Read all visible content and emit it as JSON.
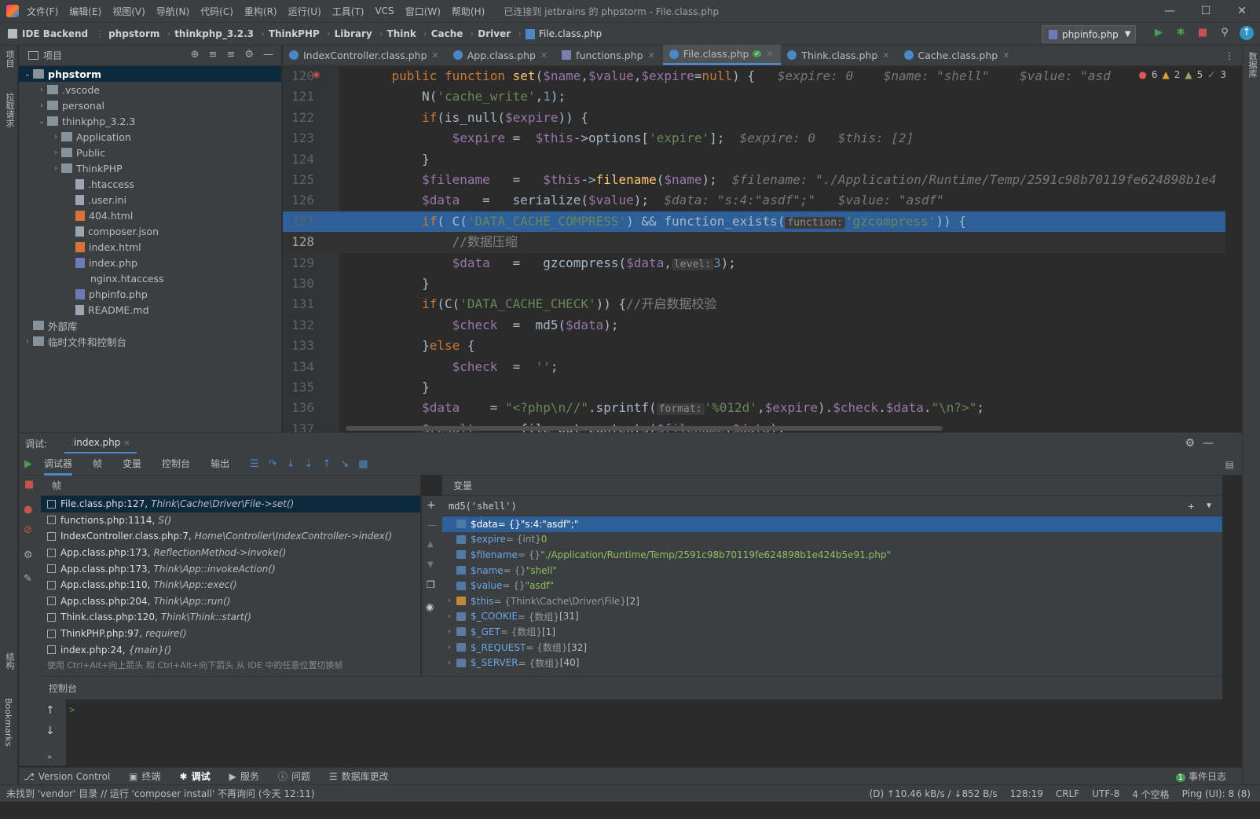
{
  "title": {
    "menu": [
      "文件(F)",
      "编辑(E)",
      "视图(V)",
      "导航(N)",
      "代码(C)",
      "重构(R)",
      "运行(U)",
      "工具(T)",
      "VCS",
      "窗口(W)",
      "帮助(H)"
    ],
    "window_title": "已连接到 jetbrains 的 phpstorm - File.class.php",
    "controls": [
      "—",
      "☐",
      "✕"
    ]
  },
  "nav": {
    "project_label": "IDE Backend",
    "breadcrumbs": [
      "phpstorm",
      "thinkphp_3.2.3",
      "ThinkPHP",
      "Library",
      "Think",
      "Cache",
      "Driver"
    ],
    "current_file": "File.class.php",
    "run_config": "phpinfo.php"
  },
  "left_strip": {
    "project": "项目",
    "pull": "拉取请求",
    "structure": "结构",
    "bookmarks": "Bookmarks"
  },
  "right_strip": {
    "db": "数据库"
  },
  "project": {
    "header": "项目",
    "items": [
      {
        "label": "phpstorm",
        "depth": 0,
        "arrow": "⌄",
        "type": "folder",
        "sel": true
      },
      {
        "label": ".vscode",
        "depth": 1,
        "arrow": "›",
        "type": "folder"
      },
      {
        "label": "personal",
        "depth": 1,
        "arrow": "›",
        "type": "folder"
      },
      {
        "label": "thinkphp_3.2.3",
        "depth": 1,
        "arrow": "⌄",
        "type": "folder"
      },
      {
        "label": "Application",
        "depth": 2,
        "arrow": "›",
        "type": "folder"
      },
      {
        "label": "Public",
        "depth": 2,
        "arrow": "›",
        "type": "folder"
      },
      {
        "label": "ThinkPHP",
        "depth": 2,
        "arrow": "›",
        "type": "folder"
      },
      {
        "label": ".htaccess",
        "depth": 3,
        "arrow": "",
        "type": "file"
      },
      {
        "label": ".user.ini",
        "depth": 3,
        "arrow": "",
        "type": "file"
      },
      {
        "label": "404.html",
        "depth": 3,
        "arrow": "",
        "type": "html"
      },
      {
        "label": "composer.json",
        "depth": 3,
        "arrow": "",
        "type": "file"
      },
      {
        "label": "index.html",
        "depth": 3,
        "arrow": "",
        "type": "html"
      },
      {
        "label": "index.php",
        "depth": 3,
        "arrow": "",
        "type": "php"
      },
      {
        "label": "nginx.htaccess",
        "depth": 3,
        "arrow": "",
        "type": "none"
      },
      {
        "label": "phpinfo.php",
        "depth": 3,
        "arrow": "",
        "type": "php"
      },
      {
        "label": "README.md",
        "depth": 3,
        "arrow": "",
        "type": "file"
      },
      {
        "label": "外部库",
        "depth": 0,
        "arrow": "",
        "type": "lib"
      },
      {
        "label": "临时文件和控制台",
        "depth": 0,
        "arrow": "›",
        "type": "lib"
      }
    ]
  },
  "tabs": [
    {
      "label": "IndexController.class.php",
      "active": false
    },
    {
      "label": "App.class.php",
      "active": false
    },
    {
      "label": "functions.php",
      "active": false
    },
    {
      "label": "File.class.php",
      "active": true
    },
    {
      "label": "Think.class.php",
      "active": false
    },
    {
      "label": "Cache.class.php",
      "active": false
    }
  ],
  "editor": {
    "errors": {
      "errors": "6",
      "warnings": "2",
      "weak": "5",
      "ok": "3"
    },
    "lines": [
      {
        "n": "120",
        "html": "    <span class='kw'>public function </span><span class='fn'>set</span>(<span class='var'>$name</span>,<span class='var'>$value</span>,<span class='var'>$expire</span>=<span class='kw'>null</span>) {   <span class='inl'>$expire: 0    $name: \"shell\"    $value: \"asd</span>"
      },
      {
        "n": "121",
        "html": "        N(<span class='str'>'cache_write'</span>,<span class='num'>1</span>);"
      },
      {
        "n": "122",
        "html": "        <span class='kw'>if</span>(is_null(<span class='var'>$expire</span>)) {"
      },
      {
        "n": "123",
        "html": "            <span class='var'>$expire</span> =  <span class='var'>$this</span>->options[<span class='str'>'expire'</span>];  <span class='inl'>$expire: 0   $this: [2]</span>"
      },
      {
        "n": "124",
        "html": "        }"
      },
      {
        "n": "125",
        "html": "        <span class='var'>$filename</span>   =   <span class='var'>$this</span>-><span class='fn'>filename</span>(<span class='var'>$name</span>);  <span class='inl'>$filename: \"./Application/Runtime/Temp/2591c98b70119fe624898b1e4</span>"
      },
      {
        "n": "126",
        "html": "        <span class='var'>$data</span>   =   serialize(<span class='var'>$value</span>);  <span class='inl'>$data: \"s:4:\"asdf\";\"   $value: \"asdf\"</span>"
      },
      {
        "n": "127",
        "html": "        <span class='kw'>if</span>( C(<span class='str'>'DATA_CACHE_COMPRESS'</span>) && function_exists(<span class='hint'>function:</span><span class='str'>'gzcompress'</span>)) {",
        "hl": true
      },
      {
        "n": "128",
        "html": "            <span class='cm'>//数据压缩</span>",
        "cur": true
      },
      {
        "n": "129",
        "html": "            <span class='var'>$data</span>   =   gzcompress(<span class='var'>$data</span>,<span class='hint'>level:</span><span class='num'>3</span>);"
      },
      {
        "n": "130",
        "html": "        }"
      },
      {
        "n": "131",
        "html": "        <span class='kw'>if</span>(C(<span class='str'>'DATA_CACHE_CHECK'</span>)) {<span class='cm'>//开启数据校验</span>"
      },
      {
        "n": "132",
        "html": "            <span class='var'>$check</span>  =  md5(<span class='var'>$data</span>);"
      },
      {
        "n": "133",
        "html": "        }<span class='kw'>else</span> {"
      },
      {
        "n": "134",
        "html": "            <span class='var'>$check</span>  =  <span class='str'>''</span>;"
      },
      {
        "n": "135",
        "html": "        }"
      },
      {
        "n": "136",
        "html": "        <span class='var'>$data</span>    = <span class='str'>\"&lt;?php\\n//\"</span>.sprintf(<span class='hint'>format:</span><span class='str'>'%012d'</span>,<span class='var'>$expire</span>).<span class='var'>$check</span>.<span class='var'>$data</span>.<span class='str'>\"\\n?&gt;\"</span>;"
      },
      {
        "n": "137",
        "html": "        <span class='var'>$result</span>  =   file_put_contents(<span class='var'>$filename</span>,<span class='var'>$data</span>);"
      }
    ]
  },
  "debug": {
    "label": "调试:",
    "session_tab": "index.php",
    "tabs": [
      "调试器",
      "帧",
      "变量",
      "控制台",
      "输出"
    ],
    "frames_header": "帧",
    "vars_header": "变量",
    "frames": [
      {
        "loc": "File.class.php:127,",
        "ctx": "Think\\Cache\\Driver\\File->set()",
        "sel": true
      },
      {
        "loc": "functions.php:1114,",
        "ctx": "S()"
      },
      {
        "loc": "IndexController.class.php:7,",
        "ctx": "Home\\Controller\\IndexController->index()"
      },
      {
        "loc": "App.class.php:173,",
        "ctx": "ReflectionMethod->invoke()"
      },
      {
        "loc": "App.class.php:173,",
        "ctx": "Think\\App::invokeAction()"
      },
      {
        "loc": "App.class.php:110,",
        "ctx": "Think\\App::exec()"
      },
      {
        "loc": "App.class.php:204,",
        "ctx": "Think\\App::run()"
      },
      {
        "loc": "Think.class.php:120,",
        "ctx": "Think\\Think::start()"
      },
      {
        "loc": "ThinkPHP.php:97,",
        "ctx": "require()"
      },
      {
        "loc": "index.php:24,",
        "ctx": "{main}()"
      }
    ],
    "frames_hint": "使用 Ctrl+Alt+向上箭头 和 Ctrl+Alt+向下箭头 从 IDE 中的任意位置切换帧",
    "watch": "md5('shell')",
    "vars": [
      {
        "arrow": "",
        "name": "$data",
        "type": " = {} ",
        "val": "\"s:4:\"asdf\";\"",
        "sel": true
      },
      {
        "arrow": "",
        "name": "$expire",
        "type": " = {int} ",
        "val": "0"
      },
      {
        "arrow": "",
        "name": "$filename",
        "type": " = {} ",
        "val": "\"./Application/Runtime/Temp/2591c98b70119fe624898b1e424b5e91.php\""
      },
      {
        "arrow": "",
        "name": "$name",
        "type": " = {} ",
        "val": "\"shell\""
      },
      {
        "arrow": "",
        "name": "$value",
        "type": " = {} ",
        "val": "\"asdf\""
      },
      {
        "arrow": "›",
        "name": "$this",
        "type": " = {Think\\Cache\\Driver\\File} ",
        "val": "[2]"
      },
      {
        "arrow": "›",
        "name": "$_COOKIE",
        "type": " = {数组} ",
        "val": "[31]"
      },
      {
        "arrow": "›",
        "name": "$_GET",
        "type": " = {数组} ",
        "val": "[1]"
      },
      {
        "arrow": "›",
        "name": "$_REQUEST",
        "type": " = {数组} ",
        "val": "[32]"
      },
      {
        "arrow": "›",
        "name": "$_SERVER",
        "type": " = {数组} ",
        "val": "[40]"
      }
    ],
    "console_label": "控制台",
    "console_prompt": ">"
  },
  "toolwindows": [
    "Version Control",
    "终端",
    "调试",
    "服务",
    "问题",
    "数据库更改"
  ],
  "event_log": "事件日志",
  "status": {
    "message": "未找到 'vendor' 目录 // 运行 'composer install'   不再询问 (今天 12:11)",
    "net": "(D) ↑10.46 kB/s / ↓852 B/s",
    "pos": "128:19",
    "eol": "CRLF",
    "enc": "UTF-8",
    "indent": "4 个空格",
    "ping": "Ping (UI): 8 (8)"
  }
}
